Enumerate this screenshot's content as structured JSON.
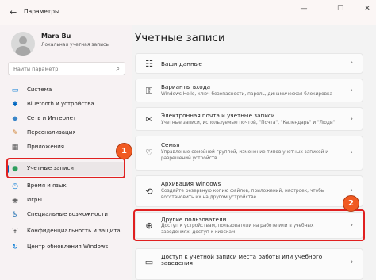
{
  "titlebar": {
    "back": "←",
    "title": "Параметры",
    "min": "—",
    "max": "☐",
    "close": "✕"
  },
  "user": {
    "name": "Mara Bu",
    "account_type": "Локальная учетная запись"
  },
  "search": {
    "placeholder": "Найти параметр",
    "icon": "⌕"
  },
  "sidebar": {
    "items": [
      {
        "label": "Система",
        "icon": "▭",
        "color": "#0078d4"
      },
      {
        "label": "Bluetooth и устройства",
        "icon": "✱",
        "color": "#0067c0"
      },
      {
        "label": "Сеть и Интернет",
        "icon": "◆",
        "color": "#3a86c8"
      },
      {
        "label": "Персонализация",
        "icon": "✎",
        "color": "#d08030"
      },
      {
        "label": "Приложения",
        "icon": "▦",
        "color": "#555555"
      },
      {
        "label": "Учетные записи",
        "icon": "●",
        "color": "#2e9e5e"
      },
      {
        "label": "Время и язык",
        "icon": "◷",
        "color": "#0078d4"
      },
      {
        "label": "Игры",
        "icon": "◉",
        "color": "#666666"
      },
      {
        "label": "Специальные возможности",
        "icon": "♿",
        "color": "#1f6fb2"
      },
      {
        "label": "Конфиденциальность и защита",
        "icon": "⛨",
        "color": "#666666"
      },
      {
        "label": "Центр обновления Windows",
        "icon": "↻",
        "color": "#0078d4"
      }
    ],
    "active_index": 5
  },
  "main": {
    "title": "Учетные записи",
    "cards": [
      {
        "title": "Ваши данные",
        "desc": "",
        "icon": "☷"
      },
      {
        "title": "Варианты входа",
        "desc": "Windows Hello, ключ безопасности, пароль, динамическая блокировка",
        "icon": "⚿"
      },
      {
        "title": "Электронная почта и учетные записи",
        "desc": "Учетные записи, используемые почтой, \"Почта\", \"Календарь\" и \"Люди\"",
        "icon": "✉"
      },
      {
        "title": "Семья",
        "desc": "Управление семейной группой, изменение типов учетных записей и разрешений устройств",
        "icon": "♡"
      },
      {
        "title": "Архивация Windows",
        "desc": "Создайте резервную копию файлов, приложений, настроек, чтобы восстановить их на другом устройстве",
        "icon": "⟲"
      },
      {
        "title": "Другие пользователи",
        "desc": "Доступ к устройствам, пользователи на работе или в учебных заведениях, доступ к киоскам",
        "icon": "⊕"
      },
      {
        "title": "Доступ к учетной записи места работы или учебного заведения",
        "desc": "",
        "icon": "▭"
      }
    ],
    "chevron": "›"
  },
  "annotations": {
    "badge1": "1",
    "badge2": "2",
    "color": "#f15a22"
  }
}
